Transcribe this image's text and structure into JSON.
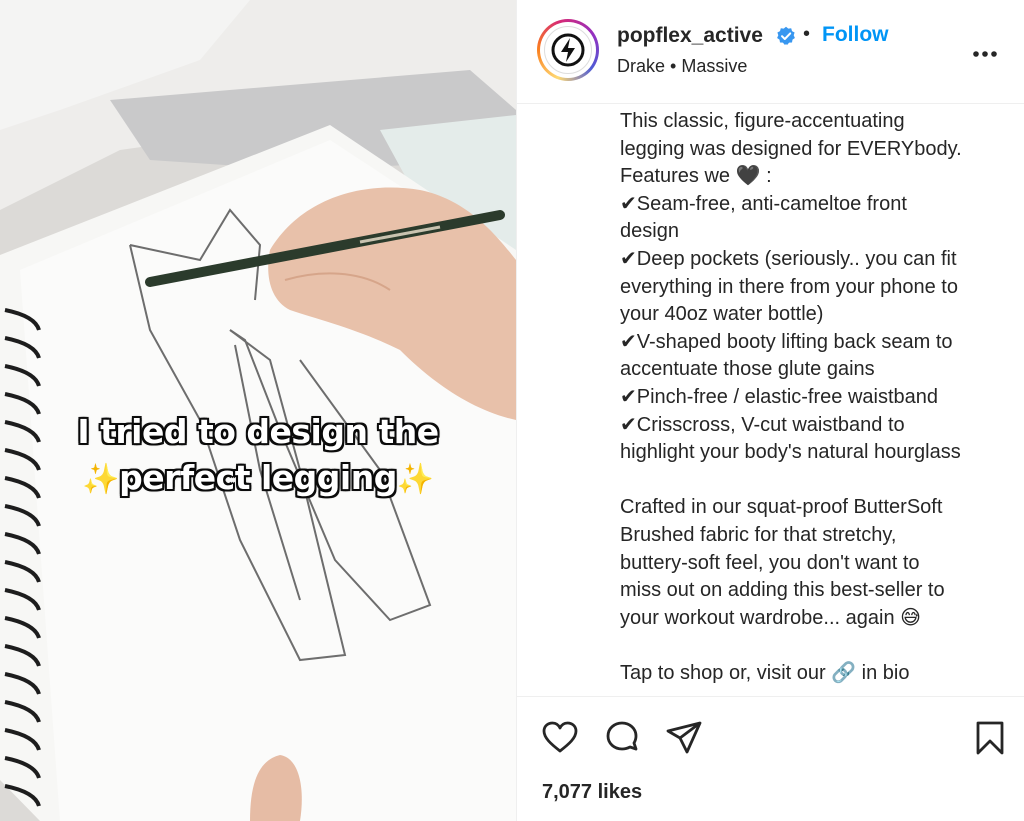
{
  "post": {
    "media": {
      "overlay_line1": "I tried to design the",
      "overlay_line2": "perfect legging",
      "sparkle": "✨"
    },
    "header": {
      "username": "popflex_active",
      "verified": true,
      "separator": "•",
      "follow_label": "Follow",
      "audio": "Drake • Massive",
      "more_icon": "more-horizontal-icon"
    },
    "caption": [
      "This classic, figure-accentuating",
      "legging was designed for EVERYbody.",
      "Features we 🖤 :",
      "✔Seam-free, anti-cameltoe front",
      "design",
      "✔Deep pockets (seriously.. you can fit",
      "everything in there from your phone to",
      "your 40oz water bottle)",
      "✔V-shaped booty lifting back seam to",
      "accentuate those glute gains",
      "✔Pinch-free / elastic-free waistband",
      "✔Crisscross, V-cut waistband to",
      "highlight your body's natural hourglass",
      "",
      "Crafted in our squat-proof ButterSoft",
      "Brushed fabric for that stretchy,",
      "buttery-soft feel, you don't want to",
      "miss out on adding this best-seller to",
      "your workout wardrobe... again 😅",
      "",
      "Tap to shop or, visit our 🔗 in bio"
    ],
    "actions": {
      "like_icon": "heart-icon",
      "comment_icon": "comment-icon",
      "share_icon": "send-icon",
      "save_icon": "bookmark-icon"
    },
    "likes": "7,077 likes"
  },
  "colors": {
    "follow_blue": "#0095f6",
    "verified_blue": "#3897f0",
    "text": "#262626"
  }
}
